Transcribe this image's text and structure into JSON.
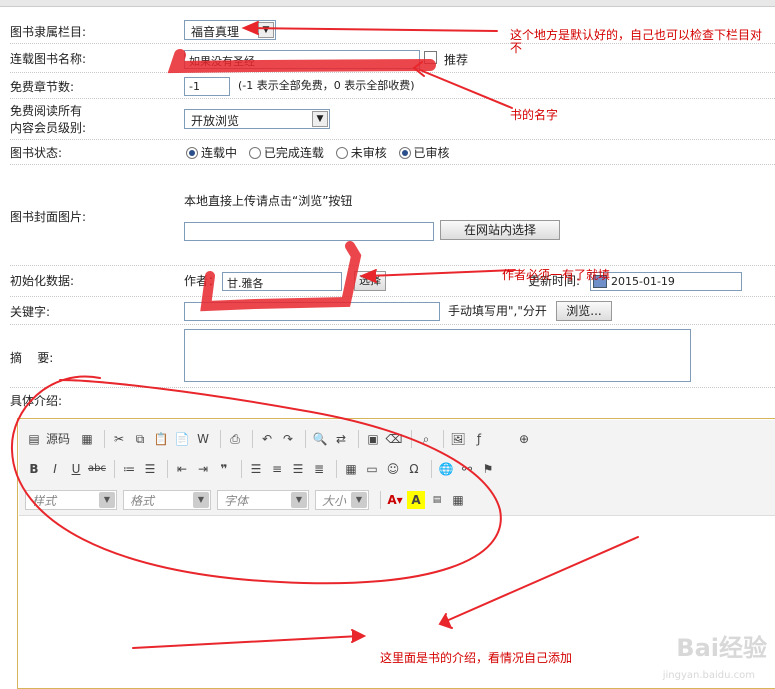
{
  "form": {
    "category_label": "图书隶属栏目:",
    "category_value": "福音真理",
    "book_name_label": "连载图书名称:",
    "book_name_value": "如果没有圣经",
    "recommend_label": "推荐",
    "free_chapters_label": "免费章节数:",
    "free_chapters_value": "-1",
    "free_chapters_hint": "(-1 表示全部免费，0 表示全部收费)",
    "free_level_label_1": "免费阅读所有",
    "free_level_label_2": "内容会员级别:",
    "free_level_value": "开放浏览",
    "status_label": "图书状态:",
    "status_options": [
      {
        "label": "连载中",
        "checked": true
      },
      {
        "label": "已完成连载",
        "checked": false
      },
      {
        "label": "未审核",
        "checked": false
      },
      {
        "label": "已审核",
        "checked": true
      }
    ],
    "cover_label": "图书封面图片:",
    "cover_hint": "本地直接上传请点击“浏览”按钮",
    "cover_select_button": "在网站内选择",
    "init_label": "初始化数据:",
    "author_label": "作者：",
    "author_value": "甘.雅各",
    "author_select_button": "选择",
    "update_time_label": "更新时间:",
    "update_time_value": "2015-01-19",
    "keywords_label": "关键字:",
    "keywords_hint": "手动填写用\",\"分开",
    "browse_button": "浏览...",
    "summary_label": "摘    要:",
    "intro_label": "具体介绍:"
  },
  "editor": {
    "source_label": "源码",
    "style_combo": "样式",
    "format_combo": "格式",
    "font_combo": "字体",
    "size_combo": "大小"
  },
  "annotations": {
    "category_note": "这个地方是默认好的，自己也可以检查下栏目对不",
    "name_note": "书的名字",
    "author_note": "作者必须一有了就填",
    "intro_note": "这里面是书的介绍，看情况自己添加"
  },
  "watermark": {
    "brand": "Bai经验",
    "url": "jingyan.baidu.com"
  },
  "colors": {
    "annotation": "#e8262b",
    "editor_border": "#d6b55a"
  }
}
